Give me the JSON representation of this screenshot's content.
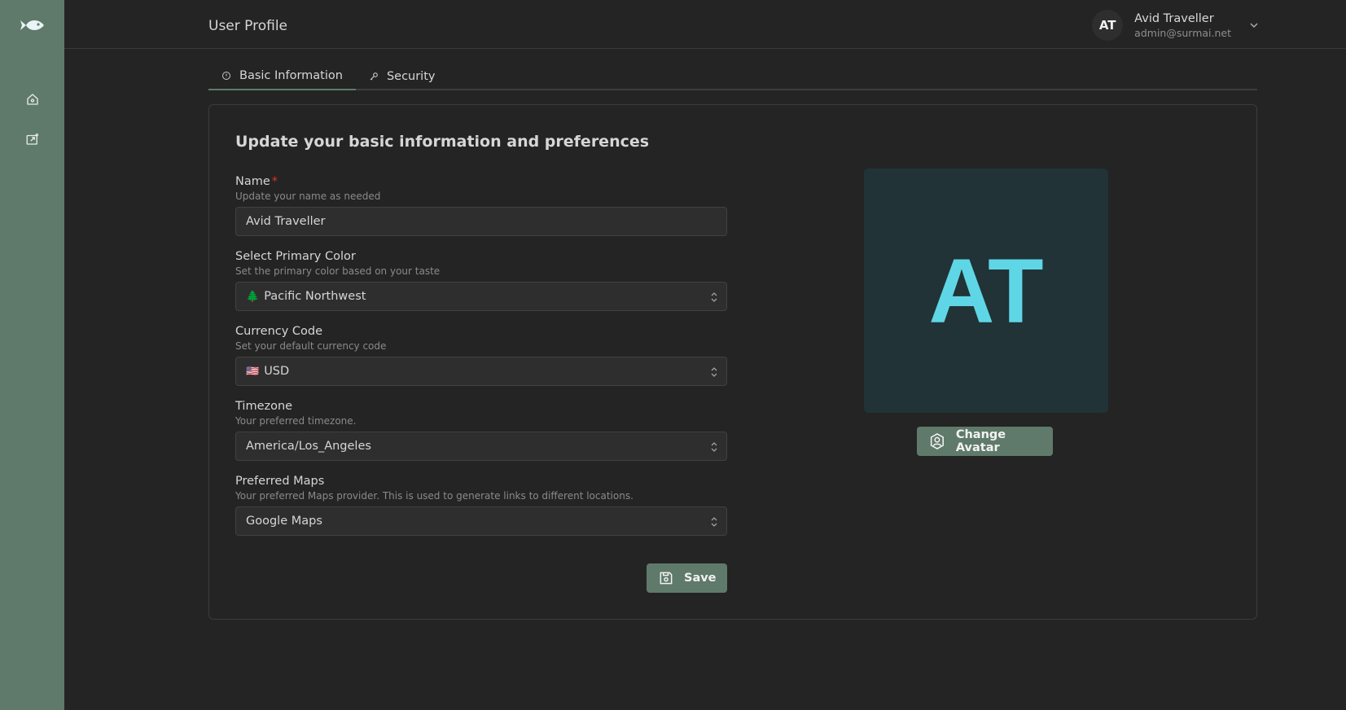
{
  "header": {
    "title": "User Profile",
    "user": {
      "initials": "AT",
      "name": "Avid Traveller",
      "email": "admin@surmai.net"
    }
  },
  "sidebar": {
    "items": [
      {
        "icon": "fish-logo-icon"
      },
      {
        "icon": "home-icon"
      },
      {
        "icon": "trips-icon"
      }
    ]
  },
  "tabs": [
    {
      "label": "Basic Information",
      "icon": "info-icon",
      "active": true
    },
    {
      "label": "Security",
      "icon": "key-icon",
      "active": false
    }
  ],
  "form": {
    "title": "Update your basic information and preferences",
    "name": {
      "label": "Name",
      "required": "*",
      "description": "Update your name as needed",
      "value": "Avid Traveller"
    },
    "primary_color": {
      "label": "Select Primary Color",
      "description": "Set the primary color based on your taste",
      "prefix": "🌲",
      "value": "Pacific Northwest"
    },
    "currency": {
      "label": "Currency Code",
      "description": "Set your default currency code",
      "prefix": "🇺🇸",
      "value": "USD"
    },
    "timezone": {
      "label": "Timezone",
      "description": "Your preferred timezone.",
      "value": "America/Los_Angeles"
    },
    "maps": {
      "label": "Preferred Maps",
      "description": "Your preferred Maps provider. This is used to generate links to different locations.",
      "value": "Google Maps"
    },
    "save_label": "Save"
  },
  "avatar": {
    "initials": "AT",
    "change_label": "Change Avatar"
  },
  "colors": {
    "sidebar": "#5f7a6a",
    "background": "#242424",
    "avatar_bg": "#213336",
    "avatar_text": "#5fd6e6",
    "required": "#e03131"
  }
}
